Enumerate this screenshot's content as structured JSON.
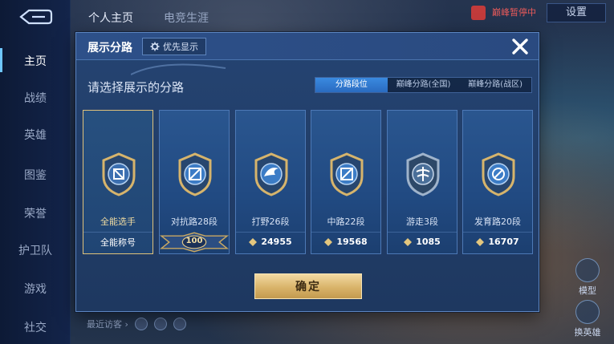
{
  "sidebar": {
    "items": [
      {
        "label": "主页",
        "active": true
      },
      {
        "label": "战绩"
      },
      {
        "label": "英雄"
      },
      {
        "label": "图鉴"
      },
      {
        "label": "荣誉"
      },
      {
        "label": "护卫队"
      },
      {
        "label": "游戏"
      },
      {
        "label": "社交"
      }
    ]
  },
  "top_tabs": [
    {
      "label": "个人主页"
    },
    {
      "label": "电竞生涯"
    }
  ],
  "topbar": {
    "notice": "巅峰暂停中",
    "settings_label": "设置"
  },
  "bottom_bar": {
    "recent_visitors_label": "最近访客 ›"
  },
  "right_floats": [
    {
      "label": "模型"
    },
    {
      "label": "换英雄"
    }
  ],
  "modal": {
    "title": "展示分路",
    "priority_label": "优先显示",
    "subtitle": "请选择展示的分路",
    "segment_tabs": [
      {
        "label": "分路段位",
        "active": true
      },
      {
        "label": "巅峰分路(全国)"
      },
      {
        "label": "巅峰分路(战区)"
      }
    ],
    "cards": [
      {
        "label": "全能选手",
        "score": "全能称号",
        "selected": true
      },
      {
        "label": "对抗路28段",
        "score": "100"
      },
      {
        "label": "打野26段",
        "score": "24955"
      },
      {
        "label": "中路22段",
        "score": "19568"
      },
      {
        "label": "游走3段",
        "score": "1085"
      },
      {
        "label": "发育路20段",
        "score": "16707"
      }
    ],
    "confirm_label": "确定"
  },
  "colors": {
    "accent_blue": "#3a8ae0",
    "gold": "#d9b46a",
    "modal_bg": "#213d68"
  }
}
